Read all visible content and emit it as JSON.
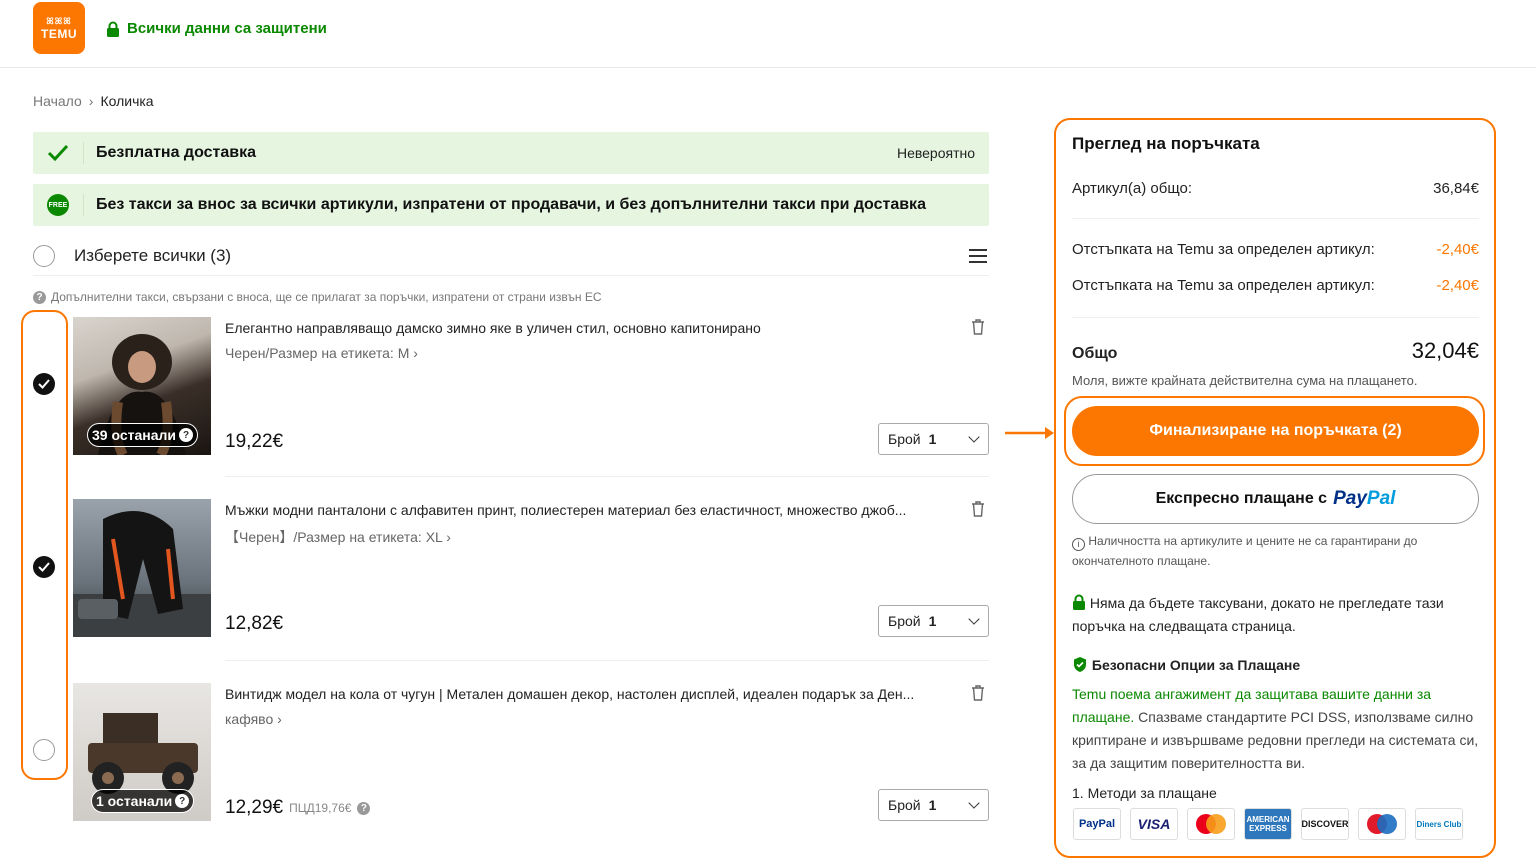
{
  "header": {
    "logo_text_top": "ꕤꕤꕤ",
    "logo_text": "TEMU",
    "secure_text": "Всички данни са защитени"
  },
  "breadcrumb": {
    "home": "Начало",
    "separator": "›",
    "current": "Количка"
  },
  "banners": {
    "free_shipping": "Безплатна доставка",
    "free_shipping_tag": "Невероятно",
    "no_fees": "Без такси за внос за всички артикули, изпратени от продавачи, и без допълнителни такси при доставка",
    "free_icon_text": "FREE"
  },
  "cart": {
    "select_all": "Изберете всички (3)",
    "customs_note": "Допълнителни такси, свързани с вноса, ще се прилагат за поръчки, изпратени от страни извън ЕС",
    "items": [
      {
        "title": "Елегантно направляващо дамско зимно яке в уличен стил, основно капитонирано",
        "variant": "Черен/Размер на етикета: M ›",
        "remaining": "39 останали",
        "price": "19,22€",
        "old_price": "",
        "qty_label": "Брой",
        "qty": "1",
        "selected": true
      },
      {
        "title": "Мъжки модни панталони с алфавитен принт, полиестерен материал без еластичност, множество джоб...",
        "variant": "【Черен】/Размер на етикета: XL ›",
        "remaining": "",
        "price": "12,82€",
        "old_price": "",
        "qty_label": "Брой",
        "qty": "1",
        "selected": true
      },
      {
        "title": "Винтидж модел на кола от чугун | Метален домашен декор, настолен дисплей, идеален подарък за Ден...",
        "variant": "кафяво ›",
        "remaining": "1 останали",
        "price": "12,29€",
        "old_price": "ПЦД19,76€",
        "qty_label": "Брой",
        "qty": "1",
        "selected": false
      }
    ]
  },
  "summary": {
    "title": "Преглед на поръчката",
    "items_total_label": "Артикул(а) общо:",
    "items_total_value": "36,84€",
    "discount1_label": "Отстъпката на Temu за определен артикул:",
    "discount1_value": "-2,40€",
    "discount2_label": "Отстъпката на Temu за определен артикул:",
    "discount2_value": "-2,40€",
    "total_label": "Общо",
    "total_value": "32,04€",
    "total_note": "Моля, вижте крайната действителна сума на плащането.",
    "checkout_button": "Финализиране на поръчката (2)",
    "paypal_prefix": "Експресно плащане с",
    "paypal_pay": "Pay",
    "paypal_pal": "Pal",
    "availability_note": "Наличността на артикулите и цените не са гарантирани до окончателното плащане.",
    "no_charge_note": "Няма да бъдете таксувани, докато не прегледате тази поръчка на следващата страница.",
    "secure_title": "Безопасни Опции за Плащане",
    "secure_link": "Temu поема ангажимент да защитава вашите данни за плащане.",
    "secure_text": " Спазваме стандартите PCI DSS, използваме силно криптиране и извършваме редовни прегледи на системата си, за да защитим поверителността ви.",
    "methods_title": "1. Методи за плащане",
    "methods": [
      "PayPal",
      "VISA",
      "",
      "AMERICAN EXPRESS",
      "DISCOVER",
      "",
      "Diners Club"
    ]
  },
  "colors": {
    "accent": "#fb7701",
    "green": "#0a8800",
    "banner_bg": "#e5f5e0"
  }
}
